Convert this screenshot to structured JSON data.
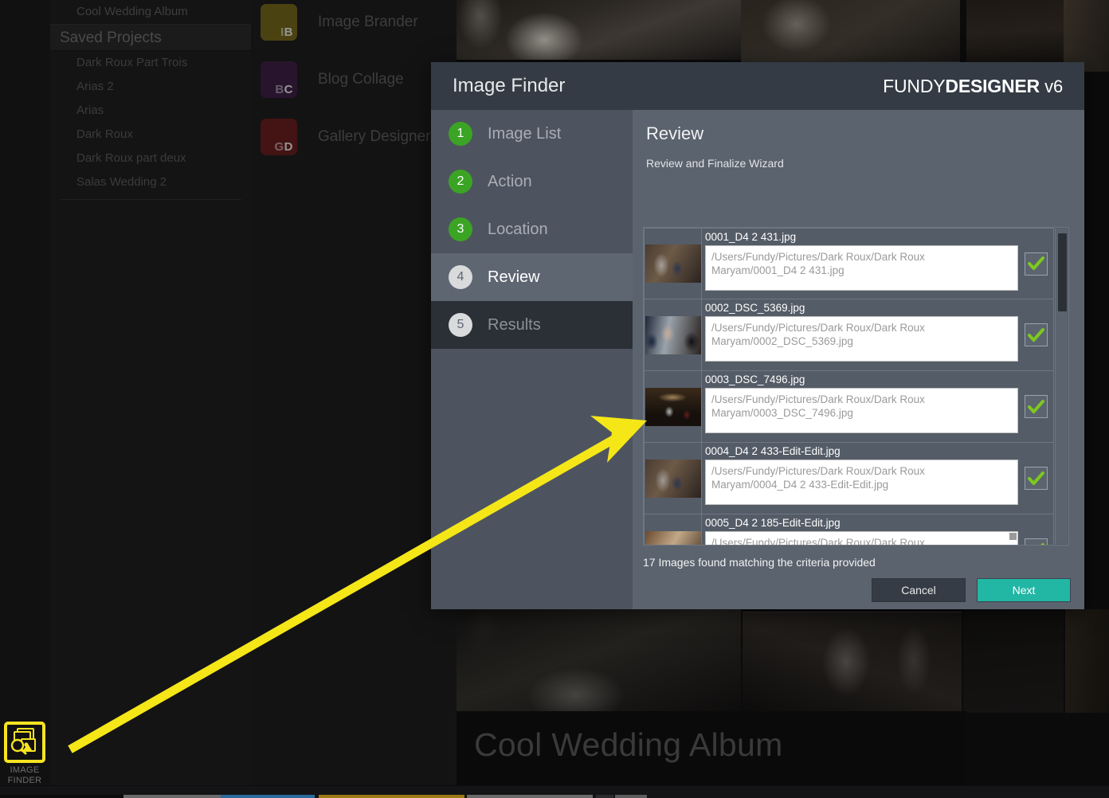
{
  "background": {
    "sidebar": {
      "top_item": "Cool Wedding Album",
      "section_header": "Saved Projects",
      "projects": [
        "Dark Roux Part Trois",
        "Arias 2",
        "Arias",
        "Dark Roux",
        "Dark Roux part deux",
        "Salas Wedding 2"
      ]
    },
    "apps": [
      {
        "label": "Image Brander",
        "abbr_light": "I",
        "abbr_bold": "B",
        "color": "#7a6a12"
      },
      {
        "label": "Blog Collage",
        "abbr_light": "B",
        "abbr_bold": "C",
        "color": "#3b1542"
      },
      {
        "label": "Gallery Designer",
        "abbr_light": "G",
        "abbr_bold": "D",
        "color": "#6d1313"
      }
    ],
    "album_caption": "Cool Wedding Album"
  },
  "dock": {
    "image_finder_label_line1": "IMAGE",
    "image_finder_label_line2": "FINDER",
    "highlight_color": "#f7e420"
  },
  "dialog": {
    "title": "Image Finder",
    "brand_light": "FUNDY",
    "brand_bold": "DESIGNER",
    "brand_version": "v6",
    "steps": [
      {
        "num": "1",
        "label": "Image List",
        "state": "done"
      },
      {
        "num": "2",
        "label": "Action",
        "state": "done"
      },
      {
        "num": "3",
        "label": "Location",
        "state": "done"
      },
      {
        "num": "4",
        "label": "Review",
        "state": "active"
      },
      {
        "num": "5",
        "label": "Results",
        "state": "pending"
      }
    ],
    "panel_title": "Review",
    "panel_subtitle": "Review and Finalize Wizard",
    "rows": [
      {
        "name": "0001_D4 2 431.jpg",
        "path": "/Users/Fundy/Pictures/Dark Roux/Dark Roux Maryam/0001_D4 2 431.jpg",
        "checked": true
      },
      {
        "name": "0002_DSC_5369.jpg",
        "path": "/Users/Fundy/Pictures/Dark Roux/Dark Roux Maryam/0002_DSC_5369.jpg",
        "checked": true
      },
      {
        "name": "0003_DSC_7496.jpg",
        "path": "/Users/Fundy/Pictures/Dark Roux/Dark Roux Maryam/0003_DSC_7496.jpg",
        "checked": true
      },
      {
        "name": "0004_D4 2 433-Edit-Edit.jpg",
        "path": "/Users/Fundy/Pictures/Dark Roux/Dark Roux Maryam/0004_D4 2 433-Edit-Edit.jpg",
        "checked": true
      },
      {
        "name": "0005_D4 2 185-Edit-Edit.jpg",
        "path": "/Users/Fundy/Pictures/Dark Roux/Dark Roux ",
        "checked": true
      }
    ],
    "found_note": "17 Images found matching the criteria provided",
    "cancel_label": "Cancel",
    "next_label": "Next",
    "next_color": "#22b6a4"
  },
  "annotation": {
    "arrow_color": "#f5e618"
  }
}
